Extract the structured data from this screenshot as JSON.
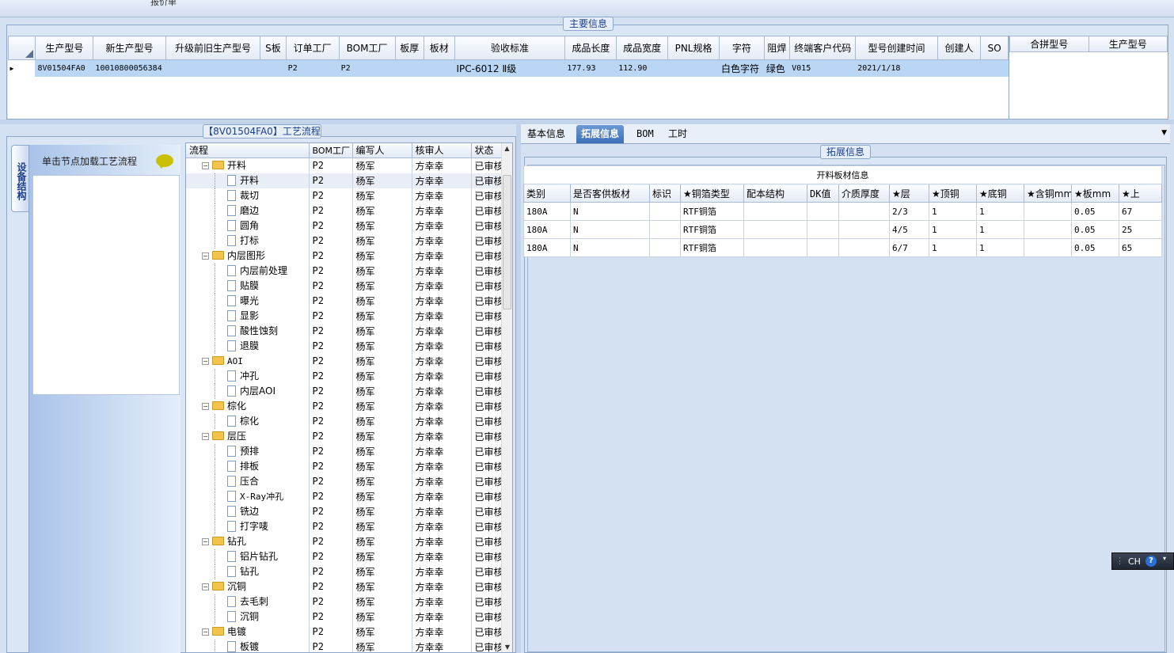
{
  "topbar": {
    "text": "报价单"
  },
  "main_info": {
    "title": "主要信息",
    "headers": [
      "生产型号",
      "新生产型号",
      "升级前旧生产型号",
      "S板",
      "订单工厂",
      "BOM工厂",
      "板厚",
      "板材",
      "验收标准",
      "成品长度",
      "成品宽度",
      "PNL规格",
      "字符",
      "阻焊",
      "终端客户代码",
      "型号创建时间",
      "创建人",
      "SO"
    ],
    "row": [
      "8V01504FA0",
      "10010800056384",
      "",
      "",
      "P2",
      "P2",
      "",
      "",
      "IPC-6012 Ⅱ级",
      "177.93",
      "112.90",
      "",
      "白色字符",
      "绿色",
      "V015",
      "2021/1/18",
      "",
      ""
    ],
    "side_headers": [
      "合拼型号",
      "生产型号"
    ]
  },
  "process": {
    "title": "【8V01504FA0】工艺流程",
    "side_tab": "设备结构",
    "hint": "单击节点加载工艺流程",
    "columns": [
      "流程",
      "BOM工厂",
      "编写人",
      "核审人",
      "状态"
    ],
    "rows": [
      {
        "name": "开料",
        "type": "folder",
        "factory": "P2",
        "writer": "杨军",
        "reviewer": "方幸幸",
        "status": "已审核"
      },
      {
        "name": "开料",
        "type": "doc",
        "factory": "P2",
        "writer": "杨军",
        "reviewer": "方幸幸",
        "status": "已审核"
      },
      {
        "name": "裁切",
        "type": "doc",
        "factory": "P2",
        "writer": "杨军",
        "reviewer": "方幸幸",
        "status": "已审核"
      },
      {
        "name": "磨边",
        "type": "doc",
        "factory": "P2",
        "writer": "杨军",
        "reviewer": "方幸幸",
        "status": "已审核"
      },
      {
        "name": "圆角",
        "type": "doc",
        "factory": "P2",
        "writer": "杨军",
        "reviewer": "方幸幸",
        "status": "已审核"
      },
      {
        "name": "打标",
        "type": "doc",
        "factory": "P2",
        "writer": "杨军",
        "reviewer": "方幸幸",
        "status": "已审核"
      },
      {
        "name": "内层图形",
        "type": "folder",
        "factory": "P2",
        "writer": "杨军",
        "reviewer": "方幸幸",
        "status": "已审核"
      },
      {
        "name": "内层前处理",
        "type": "doc",
        "factory": "P2",
        "writer": "杨军",
        "reviewer": "方幸幸",
        "status": "已审核"
      },
      {
        "name": "贴膜",
        "type": "doc",
        "factory": "P2",
        "writer": "杨军",
        "reviewer": "方幸幸",
        "status": "已审核"
      },
      {
        "name": "曝光",
        "type": "doc",
        "factory": "P2",
        "writer": "杨军",
        "reviewer": "方幸幸",
        "status": "已审核"
      },
      {
        "name": "显影",
        "type": "doc",
        "factory": "P2",
        "writer": "杨军",
        "reviewer": "方幸幸",
        "status": "已审核"
      },
      {
        "name": "酸性蚀刻",
        "type": "doc",
        "factory": "P2",
        "writer": "杨军",
        "reviewer": "方幸幸",
        "status": "已审核"
      },
      {
        "name": "退膜",
        "type": "doc",
        "factory": "P2",
        "writer": "杨军",
        "reviewer": "方幸幸",
        "status": "已审核"
      },
      {
        "name": "AOI",
        "type": "folder",
        "factory": "P2",
        "writer": "杨军",
        "reviewer": "方幸幸",
        "status": "已审核"
      },
      {
        "name": "冲孔",
        "type": "doc",
        "factory": "P2",
        "writer": "杨军",
        "reviewer": "方幸幸",
        "status": "已审核"
      },
      {
        "name": "内层AOI",
        "type": "doc",
        "factory": "P2",
        "writer": "杨军",
        "reviewer": "方幸幸",
        "status": "已审核"
      },
      {
        "name": "棕化",
        "type": "folder",
        "factory": "P2",
        "writer": "杨军",
        "reviewer": "方幸幸",
        "status": "已审核"
      },
      {
        "name": "棕化",
        "type": "doc",
        "factory": "P2",
        "writer": "杨军",
        "reviewer": "方幸幸",
        "status": "已审核"
      },
      {
        "name": "层压",
        "type": "folder",
        "factory": "P2",
        "writer": "杨军",
        "reviewer": "方幸幸",
        "status": "已审核"
      },
      {
        "name": "预排",
        "type": "doc",
        "factory": "P2",
        "writer": "杨军",
        "reviewer": "方幸幸",
        "status": "已审核"
      },
      {
        "name": "排板",
        "type": "doc",
        "factory": "P2",
        "writer": "杨军",
        "reviewer": "方幸幸",
        "status": "已审核"
      },
      {
        "name": "压合",
        "type": "doc",
        "factory": "P2",
        "writer": "杨军",
        "reviewer": "方幸幸",
        "status": "已审核"
      },
      {
        "name": "X-Ray冲孔",
        "type": "doc",
        "factory": "P2",
        "writer": "杨军",
        "reviewer": "方幸幸",
        "status": "已审核"
      },
      {
        "name": "铣边",
        "type": "doc",
        "factory": "P2",
        "writer": "杨军",
        "reviewer": "方幸幸",
        "status": "已审核"
      },
      {
        "name": "打字唛",
        "type": "doc",
        "factory": "P2",
        "writer": "杨军",
        "reviewer": "方幸幸",
        "status": "已审核"
      },
      {
        "name": "钻孔",
        "type": "folder",
        "factory": "P2",
        "writer": "杨军",
        "reviewer": "方幸幸",
        "status": "已审核"
      },
      {
        "name": "铝片钻孔",
        "type": "doc",
        "factory": "P2",
        "writer": "杨军",
        "reviewer": "方幸幸",
        "status": "已审核"
      },
      {
        "name": "钻孔",
        "type": "doc",
        "factory": "P2",
        "writer": "杨军",
        "reviewer": "方幸幸",
        "status": "已审核"
      },
      {
        "name": "沉铜",
        "type": "folder",
        "factory": "P2",
        "writer": "杨军",
        "reviewer": "方幸幸",
        "status": "已审核"
      },
      {
        "name": "去毛刺",
        "type": "doc",
        "factory": "P2",
        "writer": "杨军",
        "reviewer": "方幸幸",
        "status": "已审核"
      },
      {
        "name": "沉铜",
        "type": "doc",
        "factory": "P2",
        "writer": "杨军",
        "reviewer": "方幸幸",
        "status": "已审核"
      },
      {
        "name": "电镀",
        "type": "folder",
        "factory": "P2",
        "writer": "杨军",
        "reviewer": "方幸幸",
        "status": "已审核"
      },
      {
        "name": "板镀",
        "type": "doc",
        "factory": "P2",
        "writer": "杨军",
        "reviewer": "方幸幸",
        "status": "已审核"
      }
    ]
  },
  "tabs": [
    "基本信息",
    "拓展信息",
    "BOM",
    "工时"
  ],
  "extended": {
    "title": "拓展信息",
    "table_title": "开料板材信息",
    "headers": [
      "类别",
      "是否客供板材",
      "标识",
      "★铜箔类型",
      "配本结构",
      "DK值",
      "介质厚度",
      "★层",
      "★顶铜",
      "★底铜",
      "★含铜mm",
      "★板mm",
      "★上"
    ],
    "rows": [
      [
        "180A",
        "N",
        "",
        "RTF铜箔",
        "",
        "",
        "",
        "2/3",
        "1",
        "1",
        "",
        "0.05",
        "67"
      ],
      [
        "180A",
        "N",
        "",
        "RTF铜箔",
        "",
        "",
        "",
        "4/5",
        "1",
        "1",
        "",
        "0.05",
        "25"
      ],
      [
        "180A",
        "N",
        "",
        "RTF铜箔",
        "",
        "",
        "",
        "6/7",
        "1",
        "1",
        "",
        "0.05",
        "65"
      ]
    ]
  },
  "ime": {
    "text": "CH"
  }
}
